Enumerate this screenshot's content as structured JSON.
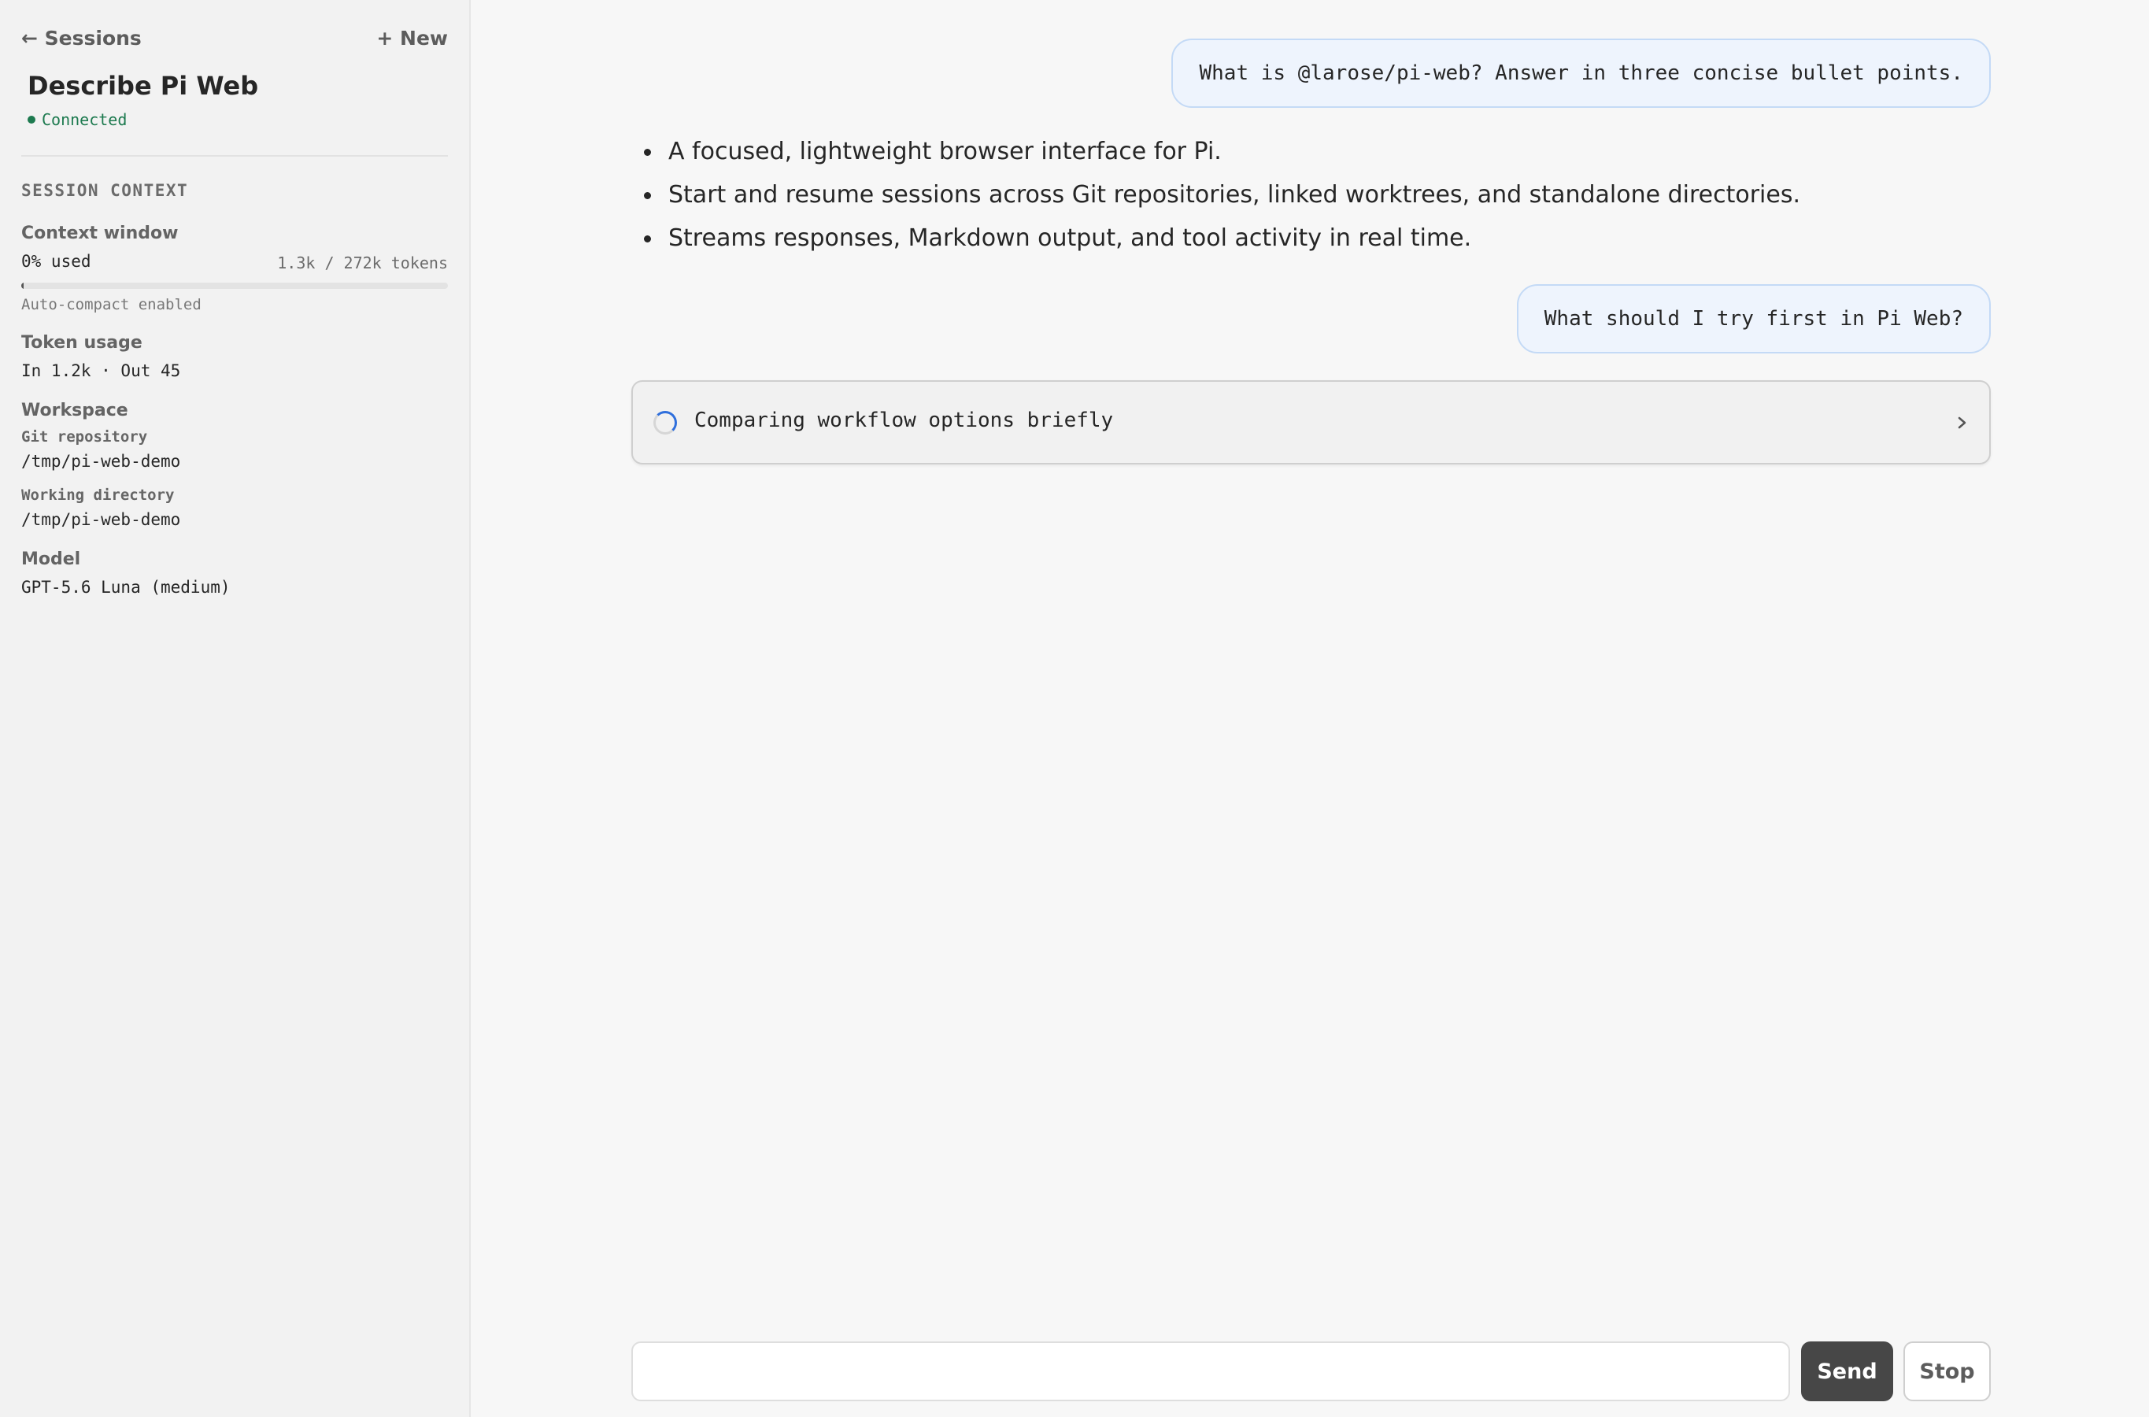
{
  "sidebar": {
    "back_label": "← Sessions",
    "new_label": "+ New",
    "session_title": "Describe Pi Web",
    "status": "Connected",
    "section_header": "SESSION CONTEXT",
    "context_window": {
      "label": "Context window",
      "used": "0% used",
      "tokens": "1.3k / 272k tokens",
      "used_fraction": 0.005,
      "note": "Auto-compact enabled"
    },
    "token_usage": {
      "label": "Token usage",
      "value": "In 1.2k · Out 45"
    },
    "workspace": {
      "label": "Workspace",
      "git_label": "Git repository",
      "git_value": "/tmp/pi-web-demo",
      "dir_label": "Working directory",
      "dir_value": "/tmp/pi-web-demo"
    },
    "model": {
      "label": "Model",
      "value": "GPT-5.6 Luna (medium)"
    }
  },
  "chat": {
    "messages": [
      {
        "role": "user",
        "text": "What is @larose/pi-web? Answer in three concise bullet points."
      },
      {
        "role": "assistant",
        "bullets": [
          "A focused, lightweight browser interface for Pi.",
          "Start and resume sessions across Git repositories, linked worktrees, and standalone directories.",
          "Streams responses, Markdown output, and tool activity in real time."
        ]
      },
      {
        "role": "user",
        "text": "What should I try first in Pi Web?"
      }
    ],
    "tool_activity": {
      "text": "Comparing workflow options briefly",
      "icon": "spinner-icon",
      "expand_icon": "chevron-right-icon"
    }
  },
  "composer": {
    "input_value": "",
    "send_label": "Send",
    "stop_label": "Stop"
  },
  "colors": {
    "accent_connected": "#1d7a4f",
    "user_bubble_bg": "#eef4fd",
    "user_bubble_border": "#c4daf6",
    "send_bg": "#474747",
    "spinner": "#2f6fdc"
  }
}
